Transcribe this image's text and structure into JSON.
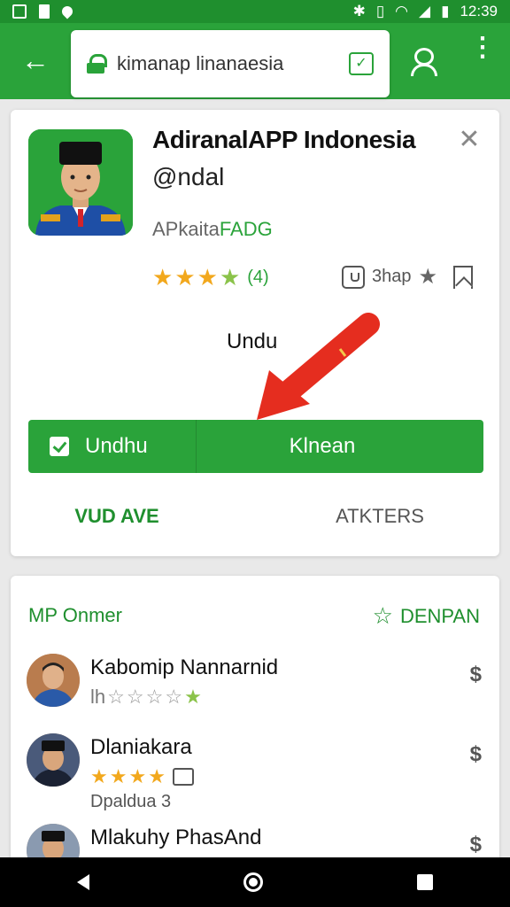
{
  "colors": {
    "brand_green": "#2aa33a",
    "dark_green": "#1f8f2e",
    "star": "#f2a81d",
    "arrow": "#e52d1f"
  },
  "status_bar": {
    "time": "12:39"
  },
  "app_bar": {
    "url": "kimanap linanaesia",
    "icons": [
      "back-arrow-icon",
      "lock-icon",
      "tab-icon",
      "account-icon",
      "more-vert-icon"
    ]
  },
  "app_card": {
    "title": "AdiranalAPP Indonesia",
    "handle": "@ndal",
    "category_prefix": "APkaita",
    "category_accent": "FADG",
    "rating_count": "(4)",
    "rating_stars": 4,
    "share_label": "3hap",
    "hint": "Undu",
    "install_label": "Undhu",
    "open_label": "Klnean",
    "tabs": [
      "VUD AVE",
      "ATKTERS"
    ]
  },
  "reviews_section": {
    "title": "MP Onmer",
    "action_label": "DENPAN",
    "reviews": [
      {
        "name": "Kabomip Nannarnid",
        "prefix": "lh",
        "rating": 1,
        "meta": ""
      },
      {
        "name": "Dlaniakara",
        "prefix": "",
        "rating": 4,
        "meta": "Dpaldua  3"
      },
      {
        "name": "Mlakuhy PhasAnd",
        "prefix": "",
        "rating": 0,
        "meta": ""
      }
    ]
  },
  "glyphs": {
    "star": "★",
    "star_empty": "☆",
    "dollar": "$",
    "close": "✕",
    "back": "←",
    "menu": "⋮",
    "tab": "✓"
  }
}
